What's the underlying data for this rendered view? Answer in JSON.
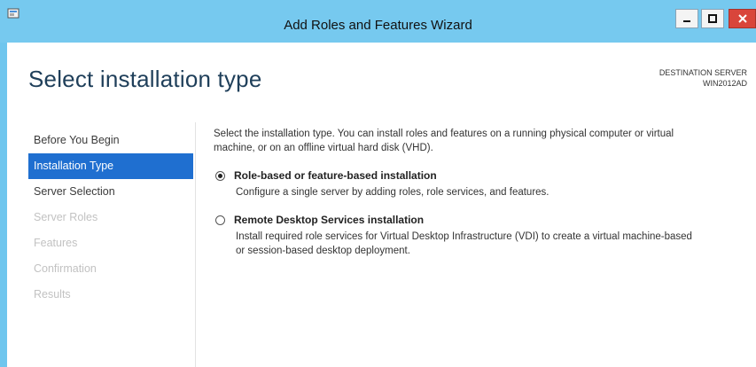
{
  "window": {
    "title": "Add Roles and Features Wizard",
    "controls": {
      "minimize": "minimize-icon",
      "maximize": "maximize-icon",
      "close": "close-icon"
    }
  },
  "header": {
    "page_title": "Select installation type",
    "destination_label": "DESTINATION SERVER",
    "destination_server": "WIN2012AD"
  },
  "nav": {
    "items": [
      {
        "label": "Before You Begin",
        "state": "normal"
      },
      {
        "label": "Installation Type",
        "state": "selected"
      },
      {
        "label": "Server Selection",
        "state": "normal"
      },
      {
        "label": "Server Roles",
        "state": "disabled"
      },
      {
        "label": "Features",
        "state": "disabled"
      },
      {
        "label": "Confirmation",
        "state": "disabled"
      },
      {
        "label": "Results",
        "state": "disabled"
      }
    ]
  },
  "content": {
    "intro_line1": "Select the installation type. You can install roles and features on a running physical computer or virtual",
    "intro_line2": "machine, or on an offline virtual hard disk (VHD).",
    "options": [
      {
        "label": "Role-based or feature-based installation",
        "desc_line1": "Configure a single server by adding roles, role services, and features.",
        "desc_line2": "",
        "selected": true
      },
      {
        "label": "Remote Desktop Services installation",
        "desc_line1": "Install required role services for Virtual Desktop Infrastructure (VDI) to create a virtual machine-based",
        "desc_line2": "or session-based desktop deployment.",
        "selected": false
      }
    ]
  },
  "colors": {
    "titlebar": "#76c9ef",
    "selected_nav": "#1f6fd0",
    "close_button": "#d9453b"
  }
}
